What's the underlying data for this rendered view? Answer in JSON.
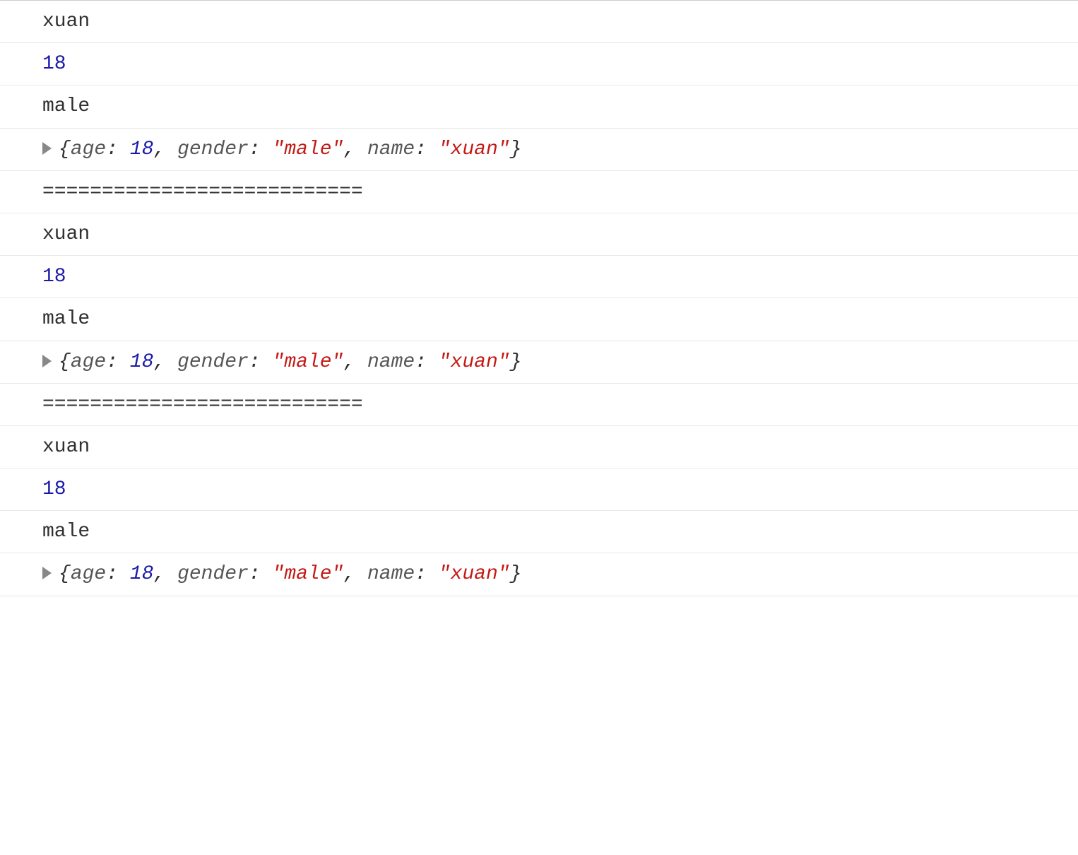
{
  "blocks": [
    {
      "lines": [
        {
          "type": "string",
          "value": "xuan"
        },
        {
          "type": "number",
          "value": "18"
        },
        {
          "type": "string",
          "value": "male"
        },
        {
          "type": "object",
          "pairs": [
            {
              "key": "age",
              "vtype": "num",
              "value": "18"
            },
            {
              "key": "gender",
              "vtype": "str",
              "value": "\"male\""
            },
            {
              "key": "name",
              "vtype": "str",
              "value": "\"xuan\""
            }
          ]
        }
      ]
    },
    {
      "lines": [
        {
          "type": "string",
          "value": "==========================="
        }
      ]
    },
    {
      "lines": [
        {
          "type": "string",
          "value": "xuan"
        },
        {
          "type": "number",
          "value": "18"
        },
        {
          "type": "string",
          "value": "male"
        },
        {
          "type": "object",
          "pairs": [
            {
              "key": "age",
              "vtype": "num",
              "value": "18"
            },
            {
              "key": "gender",
              "vtype": "str",
              "value": "\"male\""
            },
            {
              "key": "name",
              "vtype": "str",
              "value": "\"xuan\""
            }
          ]
        }
      ]
    },
    {
      "lines": [
        {
          "type": "string",
          "value": "==========================="
        }
      ]
    },
    {
      "lines": [
        {
          "type": "string",
          "value": "xuan"
        },
        {
          "type": "number",
          "value": "18"
        },
        {
          "type": "string",
          "value": "male"
        },
        {
          "type": "object",
          "pairs": [
            {
              "key": "age",
              "vtype": "num",
              "value": "18"
            },
            {
              "key": "gender",
              "vtype": "str",
              "value": "\"male\""
            },
            {
              "key": "name",
              "vtype": "str",
              "value": "\"xuan\""
            }
          ]
        }
      ]
    }
  ]
}
